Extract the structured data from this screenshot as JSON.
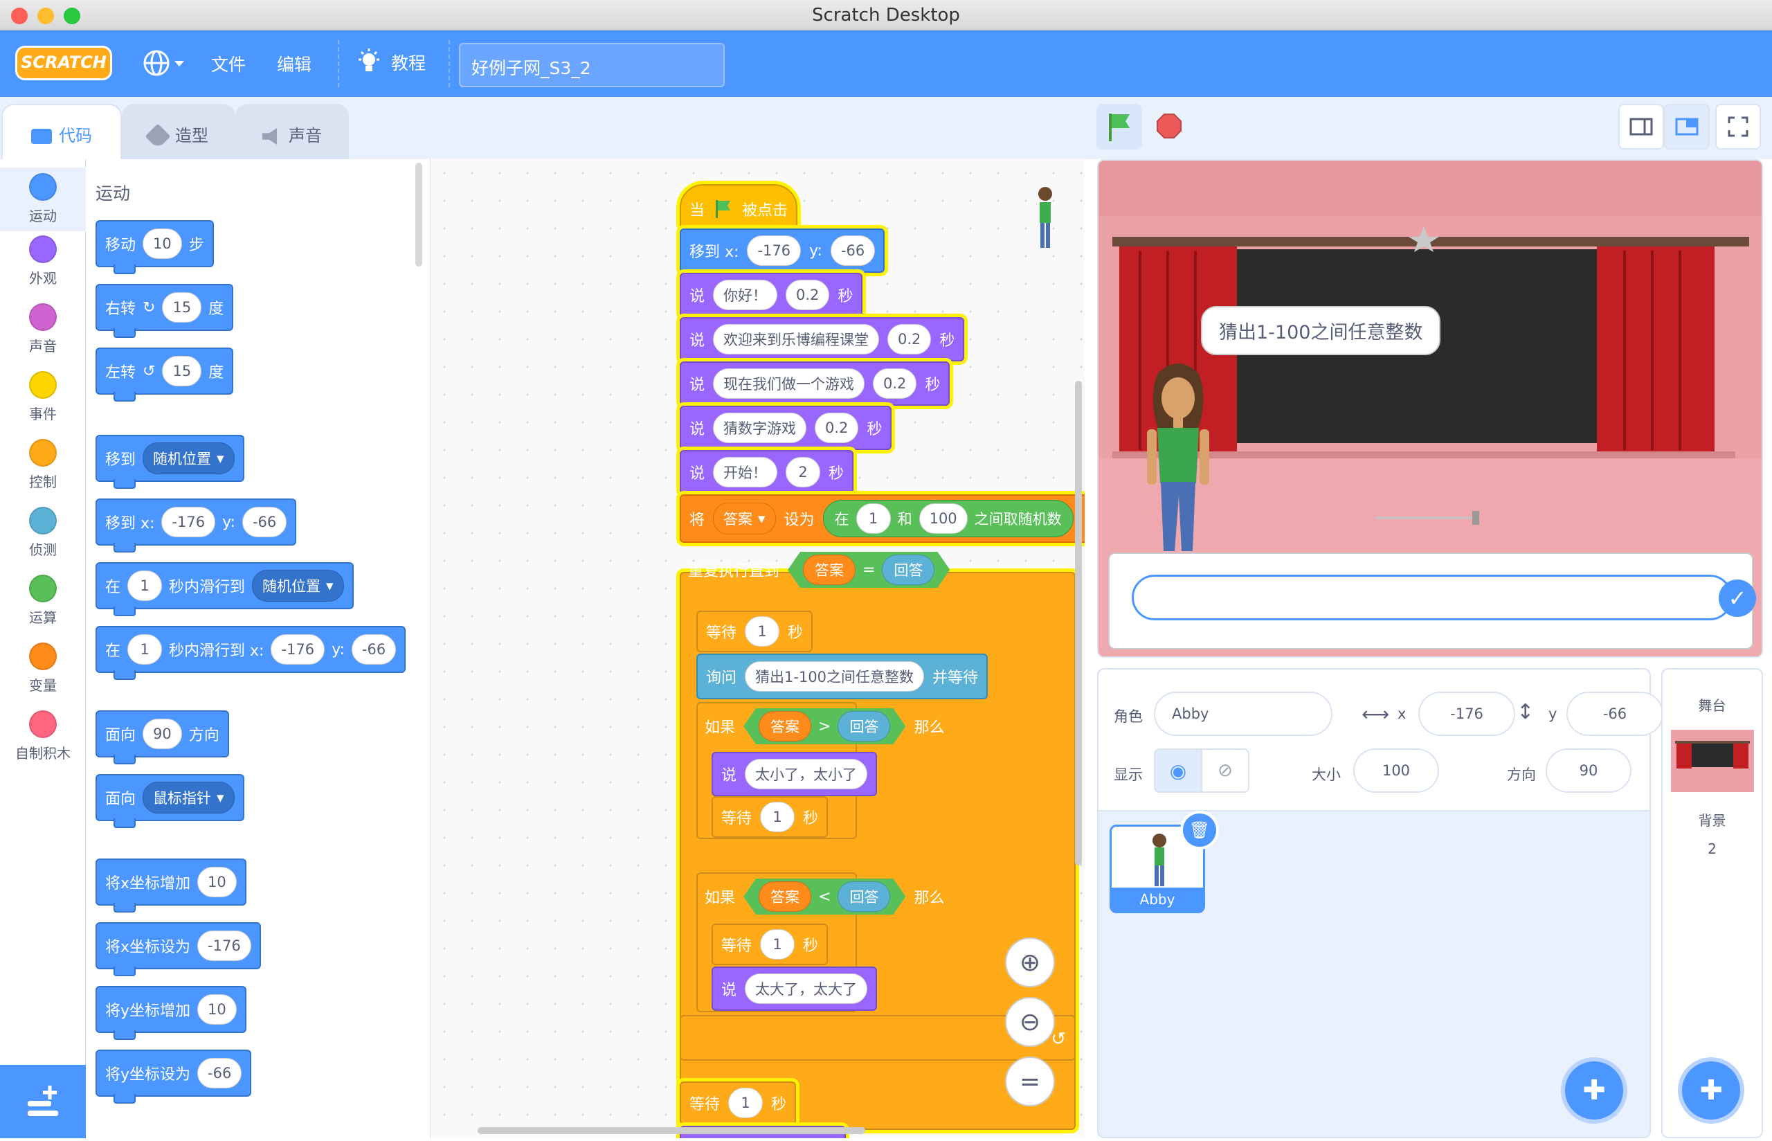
{
  "window": {
    "title": "Scratch Desktop"
  },
  "menu": {
    "logo": "SCRATCH",
    "file": "文件",
    "edit": "编辑",
    "tutorials": "教程",
    "project_title": "好例子网_S3_2"
  },
  "tabs": {
    "code": "代码",
    "costumes": "造型",
    "sounds": "声音"
  },
  "categories": [
    {
      "label": "运动",
      "color": "#4c97ff"
    },
    {
      "label": "外观",
      "color": "#9966ff"
    },
    {
      "label": "声音",
      "color": "#cf63cf"
    },
    {
      "label": "事件",
      "color": "#ffd500"
    },
    {
      "label": "控制",
      "color": "#ffab19"
    },
    {
      "label": "侦测",
      "color": "#5cb1d6"
    },
    {
      "label": "运算",
      "color": "#59c059"
    },
    {
      "label": "变量",
      "color": "#ff8c1a"
    },
    {
      "label": "自制积木",
      "color": "#ff6680"
    }
  ],
  "palette": {
    "title": "运动",
    "move": {
      "a": "移动",
      "n": "10",
      "b": "步"
    },
    "turn_right": {
      "a": "右转",
      "n": "15",
      "b": "度"
    },
    "turn_left": {
      "a": "左转",
      "n": "15",
      "b": "度"
    },
    "goto": {
      "a": "移到",
      "d": "随机位置"
    },
    "goto_xy": {
      "a": "移到 x:",
      "x": "-176",
      "b": "y:",
      "y": "-66"
    },
    "glide": {
      "a": "在",
      "n": "1",
      "b": "秒内滑行到",
      "d": "随机位置"
    },
    "glide_xy": {
      "a": "在",
      "n": "1",
      "b": "秒内滑行到 x:",
      "x": "-176",
      "c": "y:",
      "y": "-66"
    },
    "point_dir": {
      "a": "面向",
      "n": "90",
      "b": "方向"
    },
    "point_towards": {
      "a": "面向",
      "d": "鼠标指针"
    },
    "change_x": {
      "a": "将x坐标增加",
      "n": "10"
    },
    "set_x": {
      "a": "将x坐标设为",
      "n": "-176"
    },
    "change_y": {
      "a": "将y坐标增加",
      "n": "10"
    },
    "set_y": {
      "a": "将y坐标设为",
      "n": "-66"
    }
  },
  "script": {
    "hat": {
      "a": "当",
      "b": "被点击"
    },
    "goto": {
      "a": "移到 x:",
      "x": "-176",
      "b": "y:",
      "y": "-66"
    },
    "say1": {
      "a": "说",
      "t": "你好！",
      "n": "0.2",
      "b": "秒"
    },
    "say2": {
      "a": "说",
      "t": "欢迎来到乐博编程课堂",
      "n": "0.2",
      "b": "秒"
    },
    "say3": {
      "a": "说",
      "t": "现在我们做一个游戏",
      "n": "0.2",
      "b": "秒"
    },
    "say4": {
      "a": "说",
      "t": "猜数字游戏",
      "n": "0.2",
      "b": "秒"
    },
    "say5": {
      "a": "说",
      "t": "开始！",
      "n": "2",
      "b": "秒"
    },
    "setvar": {
      "a": "将",
      "v": "答案",
      "b": "设为",
      "c": "在",
      "n1": "1",
      "d": "和",
      "n2": "100",
      "e": "之间取随机数"
    },
    "repeat": {
      "a": "重复执行直到",
      "l": "答案",
      "op": "=",
      "r": "回答"
    },
    "wait1": {
      "a": "等待",
      "n": "1",
      "b": "秒"
    },
    "ask": {
      "a": "询问",
      "t": "猜出1-100之间任意整数",
      "b": "并等待"
    },
    "if1": {
      "a": "如果",
      "l": "答案",
      "op": ">",
      "r": "回答",
      "b": "那么"
    },
    "say6": {
      "a": "说",
      "t": "太小了，太小了"
    },
    "wait2": {
      "a": "等待",
      "n": "1",
      "b": "秒"
    },
    "if2": {
      "a": "如果",
      "l": "答案",
      "op": "<",
      "r": "回答",
      "b": "那么"
    },
    "wait3": {
      "a": "等待",
      "n": "1",
      "b": "秒"
    },
    "say7": {
      "a": "说",
      "t": "太大了，太大了"
    },
    "wait4": {
      "a": "等待",
      "n": "1",
      "b": "秒"
    }
  },
  "stage": {
    "bubble": "猜出1-100之间任意整数"
  },
  "sprite_info": {
    "sprite_label": "角色",
    "sprite_name": "Abby",
    "x_label": "x",
    "x": "-176",
    "y_label": "y",
    "y": "-66",
    "show_label": "显示",
    "size_label": "大小",
    "size": "100",
    "dir_label": "方向",
    "dir": "90"
  },
  "sprites": [
    {
      "name": "Abby"
    }
  ],
  "stage_pane": {
    "title": "舞台",
    "backdrop_label": "背景",
    "backdrop_count": "2"
  }
}
